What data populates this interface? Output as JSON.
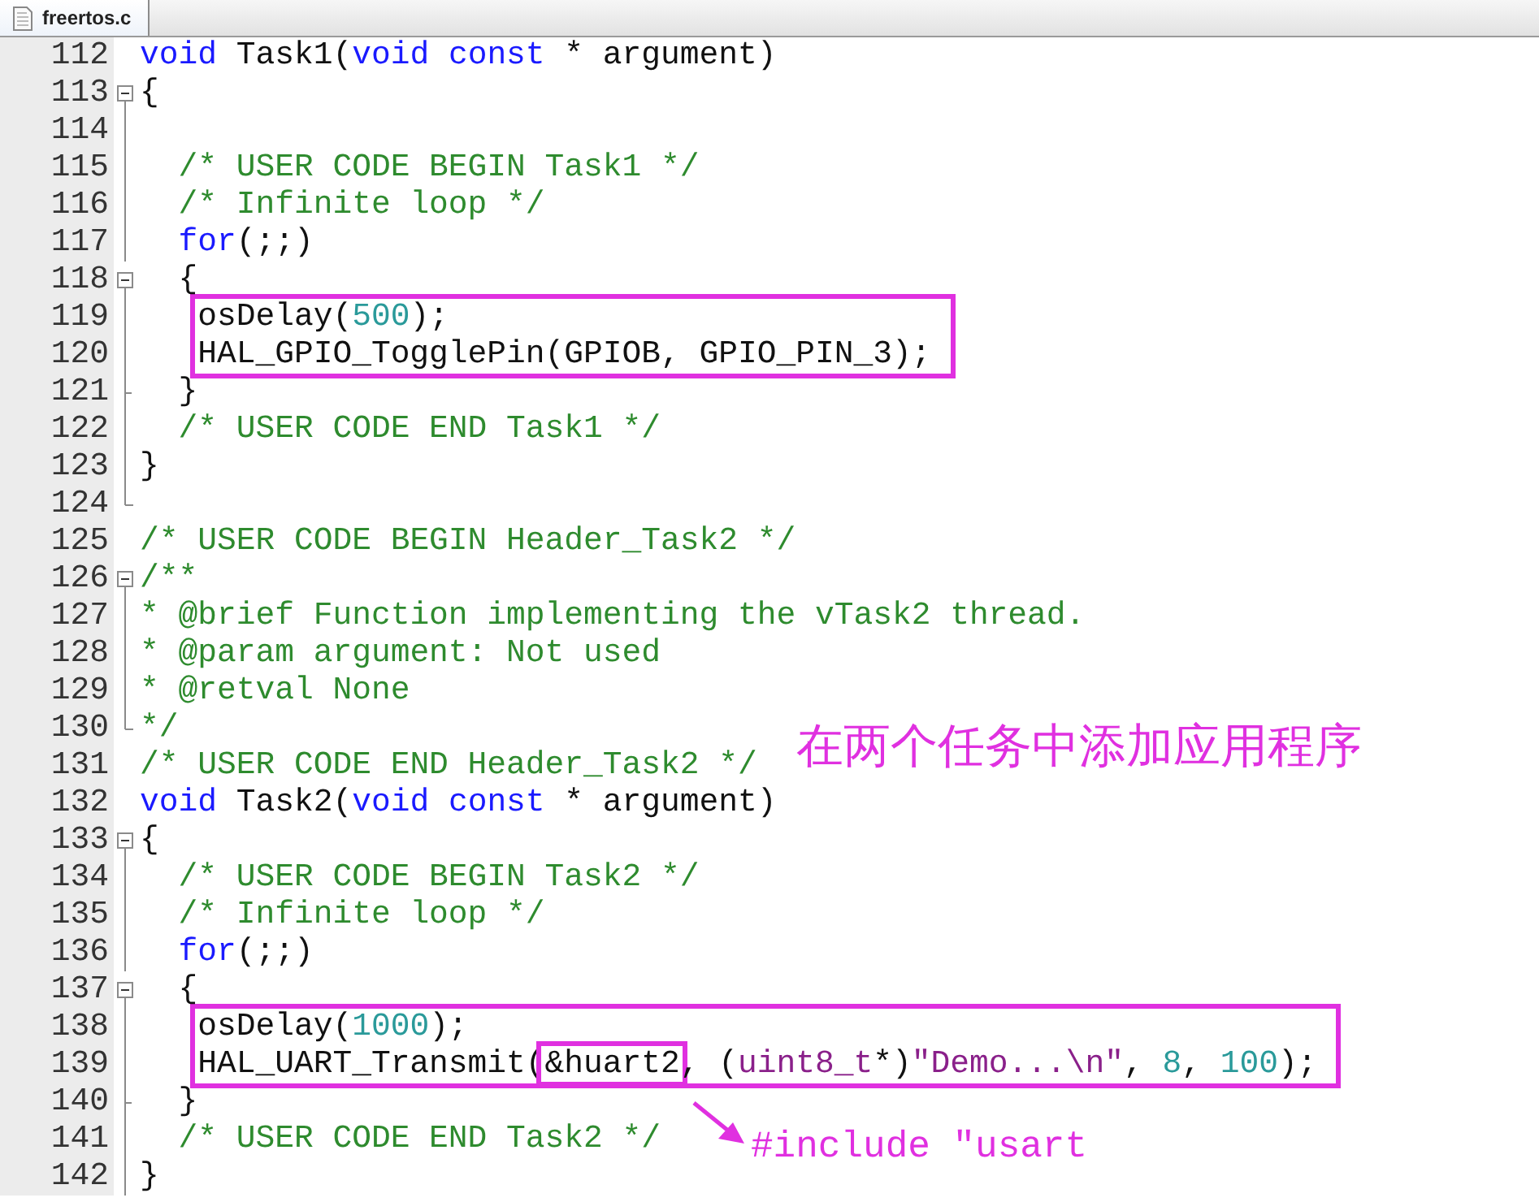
{
  "tabs": [
    {
      "label": "freertos.c",
      "selected": true
    }
  ],
  "lines": [
    {
      "number": "112",
      "kind": "plain",
      "code": [
        {
          "text": "void",
          "kind": "keyword"
        },
        {
          "text": " Task1(",
          "kind": "plain"
        },
        {
          "text": "void",
          "kind": "keyword"
        },
        {
          "text": " const",
          "kind": "keyword"
        },
        {
          "text": " * argument)",
          "kind": "plain"
        }
      ]
    },
    {
      "number": "113",
      "kind": "start",
      "code": [
        {
          "text": "{",
          "kind": "plain"
        }
      ]
    },
    {
      "number": "114",
      "kind": "body"
    },
    {
      "number": "115",
      "kind": "body",
      "code": [
        {
          "text": "  /* USER CODE BEGIN Task1 */",
          "kind": "comment"
        }
      ]
    },
    {
      "number": "116",
      "kind": "body",
      "code": [
        {
          "text": "  /* Infinite loop */",
          "kind": "comment"
        }
      ]
    },
    {
      "number": "117",
      "kind": "body",
      "code": [
        {
          "text": "  for",
          "kind": "keyword"
        },
        {
          "text": "(;;)",
          "kind": "plain"
        }
      ]
    },
    {
      "number": "118",
      "kind": "start",
      "code": [
        {
          "text": "  {",
          "kind": "plain"
        }
      ]
    },
    {
      "number": "119",
      "kind": "body",
      "boxed": true,
      "code": [
        {
          "text": "osDelay(",
          "kind": "plain"
        },
        {
          "text": "500",
          "kind": "number"
        },
        {
          "text": ");",
          "kind": "plain"
        }
      ]
    },
    {
      "number": "120",
      "kind": "body",
      "boxed": true,
      "code": [
        {
          "text": "HAL_GPIO_TogglePin(GPIOB, GPIO_PIN_3);",
          "kind": "plain"
        }
      ]
    },
    {
      "number": "121",
      "kind": "branch",
      "code": [
        {
          "text": "  }",
          "kind": "plain"
        }
      ]
    },
    {
      "number": "122",
      "kind": "body",
      "code": [
        {
          "text": "  /* USER CODE END Task1 */",
          "kind": "comment"
        }
      ]
    },
    {
      "number": "123",
      "kind": "body",
      "code": [
        {
          "text": "}",
          "kind": "plain"
        }
      ]
    },
    {
      "number": "124",
      "kind": "end"
    },
    {
      "number": "125",
      "kind": "plain",
      "code": [
        {
          "text": "/* USER CODE BEGIN Header_Task2 */",
          "kind": "comment"
        }
      ]
    },
    {
      "number": "126",
      "kind": "start",
      "code": [
        {
          "text": "/**",
          "kind": "comment"
        }
      ]
    },
    {
      "number": "127",
      "kind": "body",
      "code": [
        {
          "text": "* @brief Function implementing the vTask2 thread.",
          "kind": "comment"
        }
      ]
    },
    {
      "number": "128",
      "kind": "body",
      "code": [
        {
          "text": "* @param argument: Not used",
          "kind": "comment"
        }
      ]
    },
    {
      "number": "129",
      "kind": "body",
      "code": [
        {
          "text": "* @retval None",
          "kind": "comment"
        }
      ]
    },
    {
      "number": "130",
      "kind": "end",
      "code": [
        {
          "text": "*/",
          "kind": "comment"
        }
      ]
    },
    {
      "number": "131",
      "kind": "plain",
      "code": [
        {
          "text": "/* USER CODE END Header_Task2 */",
          "kind": "comment"
        }
      ]
    },
    {
      "number": "132",
      "kind": "plain",
      "code": [
        {
          "text": "void",
          "kind": "keyword"
        },
        {
          "text": " Task2(",
          "kind": "plain"
        },
        {
          "text": "void",
          "kind": "keyword"
        },
        {
          "text": " const",
          "kind": "keyword"
        },
        {
          "text": " * argument)",
          "kind": "plain"
        }
      ]
    },
    {
      "number": "133",
      "kind": "start",
      "code": [
        {
          "text": "{",
          "kind": "plain"
        }
      ]
    },
    {
      "number": "134",
      "kind": "body",
      "code": [
        {
          "text": "  /* USER CODE BEGIN Task2 */",
          "kind": "comment"
        }
      ]
    },
    {
      "number": "135",
      "kind": "body",
      "code": [
        {
          "text": "  /* Infinite loop */",
          "kind": "comment"
        }
      ]
    },
    {
      "number": "136",
      "kind": "body",
      "code": [
        {
          "text": "  for",
          "kind": "keyword"
        },
        {
          "text": "(;;)",
          "kind": "plain"
        }
      ]
    },
    {
      "number": "137",
      "kind": "start",
      "code": [
        {
          "text": "  {",
          "kind": "plain"
        }
      ]
    },
    {
      "number": "138",
      "kind": "body",
      "boxed": true,
      "code": [
        {
          "text": "osDelay(",
          "kind": "plain"
        },
        {
          "text": "1000",
          "kind": "number"
        },
        {
          "text": ");",
          "kind": "plain"
        }
      ]
    },
    {
      "number": "139",
      "kind": "body",
      "boxed": true,
      "code": [
        {
          "text": "HAL_UART_Transmit(",
          "kind": "plain"
        },
        {
          "text": "&huart2",
          "kind": "plain",
          "boxed": true
        },
        {
          "text": ", (",
          "kind": "plain"
        },
        {
          "text": "uint8_t",
          "kind": "type"
        },
        {
          "text": "*)",
          "kind": "plain"
        },
        {
          "text": "\"Demo...\\n\"",
          "kind": "string"
        },
        {
          "text": ", ",
          "kind": "plain"
        },
        {
          "text": "8",
          "kind": "number"
        },
        {
          "text": ", ",
          "kind": "plain"
        },
        {
          "text": "100",
          "kind": "number"
        },
        {
          "text": ");",
          "kind": "plain"
        }
      ]
    },
    {
      "number": "140",
      "kind": "branch",
      "code": [
        {
          "text": "  }",
          "kind": "plain"
        }
      ]
    },
    {
      "number": "141",
      "kind": "body",
      "code": [
        {
          "text": "  /* USER CODE END Task2 */",
          "kind": "comment"
        }
      ]
    },
    {
      "number": "142",
      "kind": "body",
      "code": [
        {
          "text": "}",
          "kind": "plain"
        }
      ]
    }
  ],
  "annotations": [
    {
      "kind": "note",
      "text": "在两个任务中添加应用程序"
    },
    {
      "kind": "hint",
      "text": "#include ″usart"
    }
  ]
}
